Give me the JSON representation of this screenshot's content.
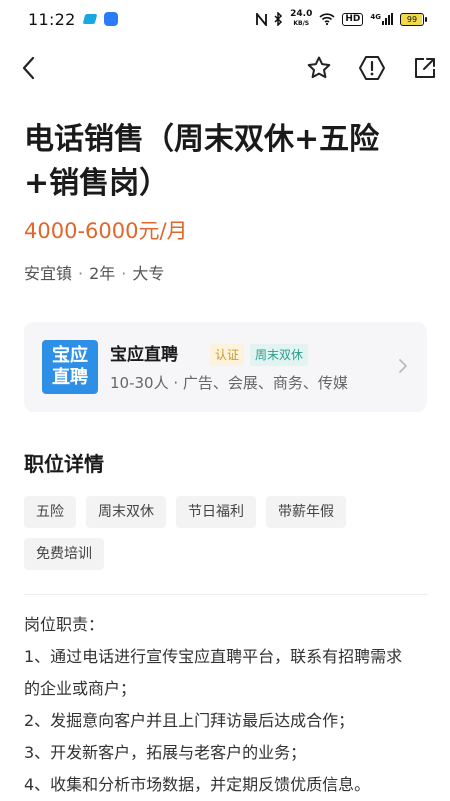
{
  "status_bar": {
    "time": "11:22",
    "network_speed_value": "24.0",
    "network_speed_unit": "KB/S",
    "hd": "HD",
    "signal_label": "4G",
    "battery": "99"
  },
  "job": {
    "title": "电话销售（周末双休+五险+销售岗）",
    "salary": "4000-6000元/月",
    "location": "安宜镇",
    "experience": "2年",
    "education": "大专",
    "separator": "·"
  },
  "company": {
    "logo_text": "宝应直聘",
    "name": "宝应直聘",
    "verified_tag": "认证",
    "benefit_tag": "周末双休",
    "description": "10-30人 · 广告、会展、商务、传媒"
  },
  "details": {
    "section_title": "职位详情",
    "tags": [
      "五险",
      "周末双休",
      "节日福利",
      "带薪年假",
      "免费培训"
    ],
    "lines": [
      "岗位职责：",
      "1、通过电话进行宣传宝应直聘平台，联系有招聘需求",
      "的企业或商户；",
      "2、发掘意向客户并且上门拜访最后达成合作；",
      "3、开发新客户，拓展与老客户的业务；",
      "4、收集和分析市场数据，并定期反馈优质信息。"
    ]
  },
  "colors": {
    "salary": "#e2662a",
    "logo_bg": "#2e8fe6",
    "verified": "#c99a2e",
    "benefit": "#2a9d8f"
  },
  "icons": {
    "back": "back-arrow-icon",
    "star": "star-icon",
    "report": "report-icon",
    "share": "share-icon",
    "chevron": "chevron-right-icon"
  }
}
